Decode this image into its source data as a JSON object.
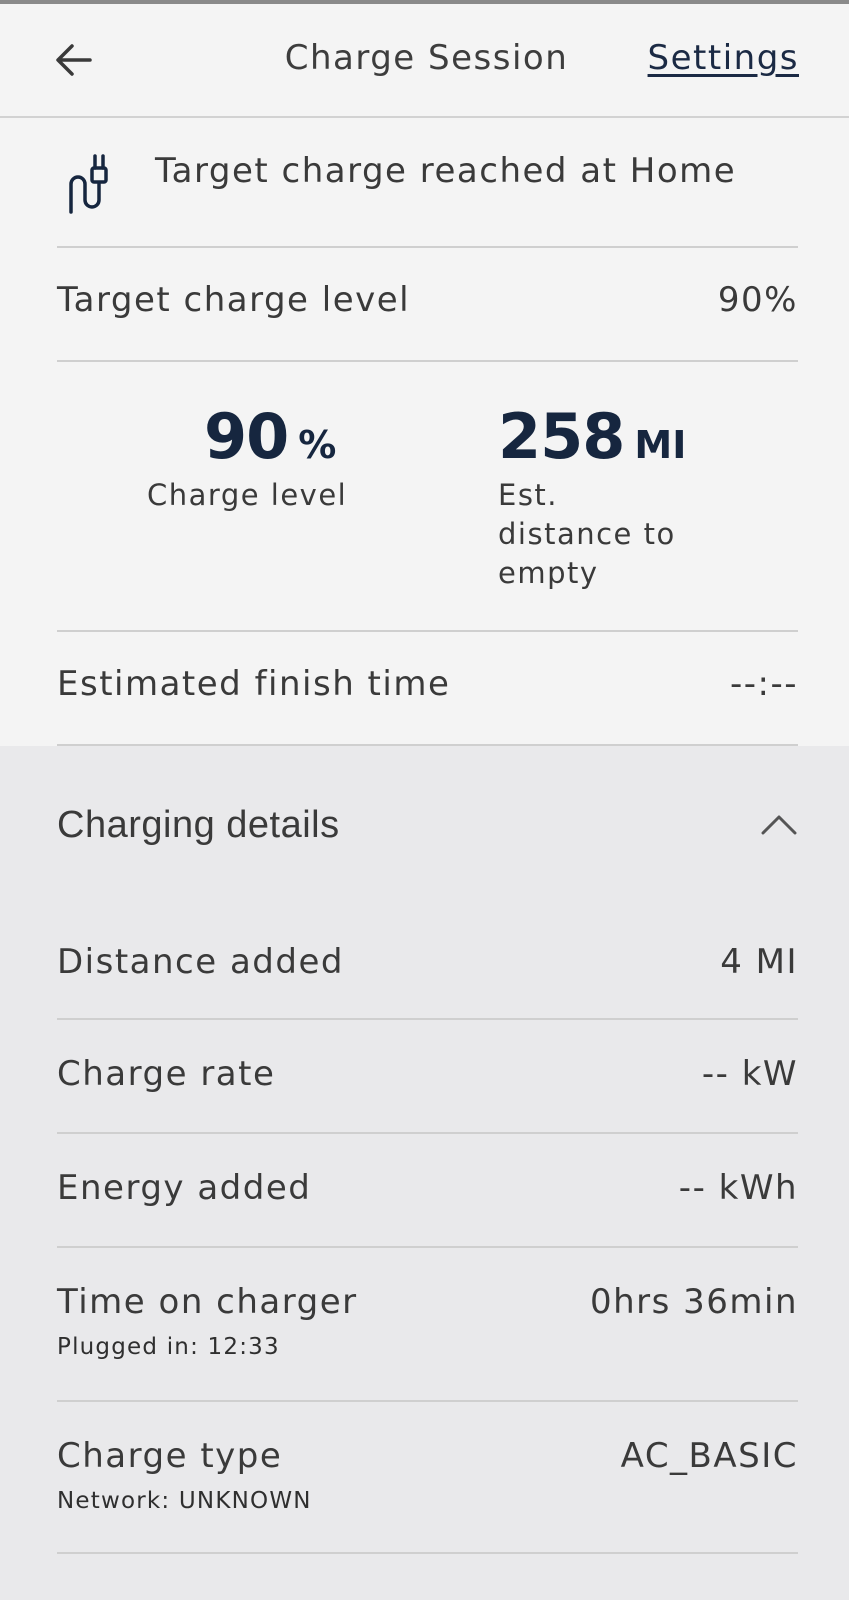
{
  "header": {
    "back_icon": "arrow-left-icon",
    "title": "Charge Session",
    "settings_label": "Settings"
  },
  "status": {
    "icon": "ev-plug-icon",
    "text": "Target charge reached at Home"
  },
  "target_charge": {
    "label": "Target charge level",
    "value": "90%"
  },
  "stats": {
    "charge_value": "90",
    "charge_unit": "%",
    "charge_label": "Charge level",
    "distance_value": "258",
    "distance_unit": "MI",
    "distance_label_1": "Est.",
    "distance_label_2": "distance to",
    "distance_label_3": "empty"
  },
  "finish_time": {
    "label": "Estimated finish time",
    "value": "--:--"
  },
  "details": {
    "title": "Charging details",
    "toggle_icon": "chevron-up-icon",
    "rows": [
      {
        "label": "Distance added",
        "value": "4 MI"
      },
      {
        "label": "Charge rate",
        "value": "-- kW"
      },
      {
        "label": "Energy added",
        "value": "-- kWh"
      },
      {
        "label": "Time on charger",
        "value": "0hrs 36min",
        "sub": "Plugged in: 12:33"
      },
      {
        "label": "Charge type",
        "value": "AC_BASIC",
        "sub": "Network: UNKNOWN"
      }
    ]
  },
  "colors": {
    "accent_navy": "#16263f",
    "background": "#f4f4f4",
    "panel_background": "#e9e9eb",
    "divider": "#cfcfcf"
  }
}
